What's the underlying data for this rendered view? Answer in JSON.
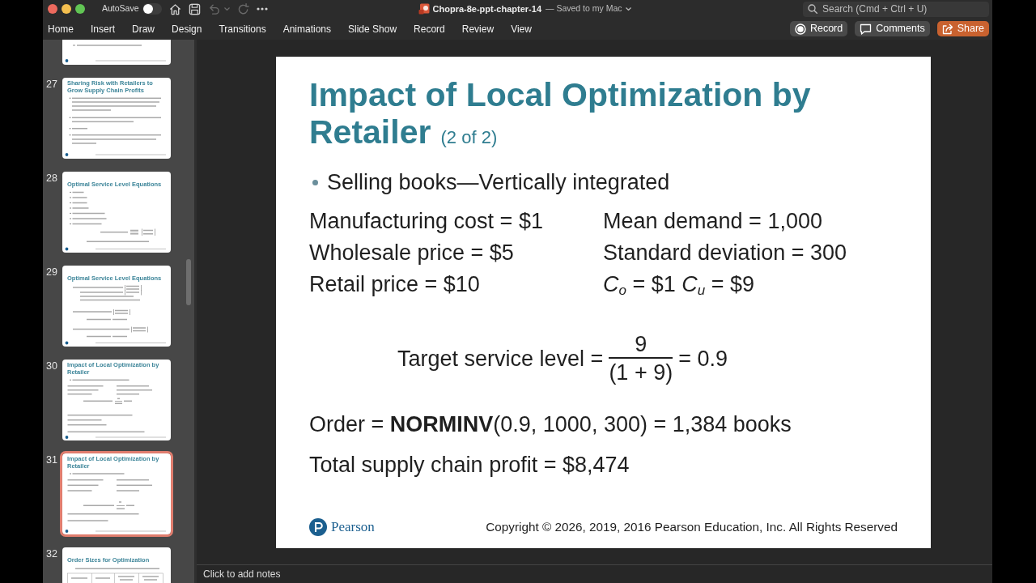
{
  "title_bar": {
    "autosave_label": "AutoSave",
    "autosave_on": false,
    "document_name": "Chopra-8e-ppt-chapter-14",
    "save_status": "— Saved to my Mac",
    "search_placeholder": "Search (Cmd + Ctrl + U)"
  },
  "quick_access": [
    {
      "kind": "home",
      "disabled": false
    },
    {
      "kind": "save",
      "disabled": false
    },
    {
      "kind": "undo",
      "disabled": true
    },
    {
      "kind": "redo",
      "disabled": true
    },
    {
      "kind": "more",
      "disabled": false
    }
  ],
  "ribbon": {
    "tabs": [
      "Home",
      "Insert",
      "Draw",
      "Design",
      "Transitions",
      "Animations",
      "Slide Show",
      "Record",
      "Review",
      "View"
    ],
    "actions": [
      {
        "kind": "record",
        "label": "Record"
      },
      {
        "kind": "comments",
        "label": "Comments"
      },
      {
        "kind": "share",
        "label": "Share"
      }
    ]
  },
  "slide_panel": {
    "thumbnails": [
      {
        "kind": "partial_bullets",
        "selected": false
      },
      {
        "kind": "bullets",
        "number": "27",
        "selected": false,
        "title": "Sharing Risk with Retailers to Grow Supply Chain Profits"
      },
      {
        "kind": "definitions",
        "number": "28",
        "selected": false,
        "title": "Optimal Service Level Equations"
      },
      {
        "kind": "equations",
        "number": "29",
        "selected": false,
        "title": "Optimal Service Level Equations"
      },
      {
        "kind": "long_calculation",
        "number": "30",
        "selected": false,
        "title": "Impact of Local Optimization by Retailer"
      },
      {
        "kind": "short_calculation",
        "number": "31",
        "selected": true,
        "title": "Impact of Local Optimization by Retailer"
      },
      {
        "kind": "table",
        "number": "32",
        "selected": false,
        "title": "Order Sizes for Optimization"
      }
    ]
  },
  "slide": {
    "title": "**Impact of Local Optimization by Retailer** (2 of 2)",
    "blocks": [
      {
        "kind": "bullet",
        "text": "Selling books—Vertically integrated"
      },
      {
        "kind": "columns",
        "left": [
          "Manufacturing cost = $1",
          "Wholesale price = $5",
          "Retail price = $10"
        ],
        "right": [
          "Mean demand = 1,000",
          "Standard deviation = 300",
          "*C*$_{o}$ = $1 *C*$_{u}$ = $9"
        ]
      },
      {
        "kind": "fraction",
        "lhs": "Target service level =",
        "numerator": "9",
        "denominator": "(1 + 9)",
        "rhs": "= 0.9"
      },
      {
        "kind": "line",
        "text": "Order = **NORMINV**(0.9, 1000, 300) = 1,384 books"
      },
      {
        "kind": "line",
        "text": "Total supply chain profit = $8,474"
      }
    ],
    "footer": {
      "logo_text": "Pearson",
      "copyright": "Copyright © 2026, 2019, 2016 Pearson Education, Inc. All Rights Reserved"
    }
  },
  "notes": {
    "placeholder": "Click to add notes"
  }
}
